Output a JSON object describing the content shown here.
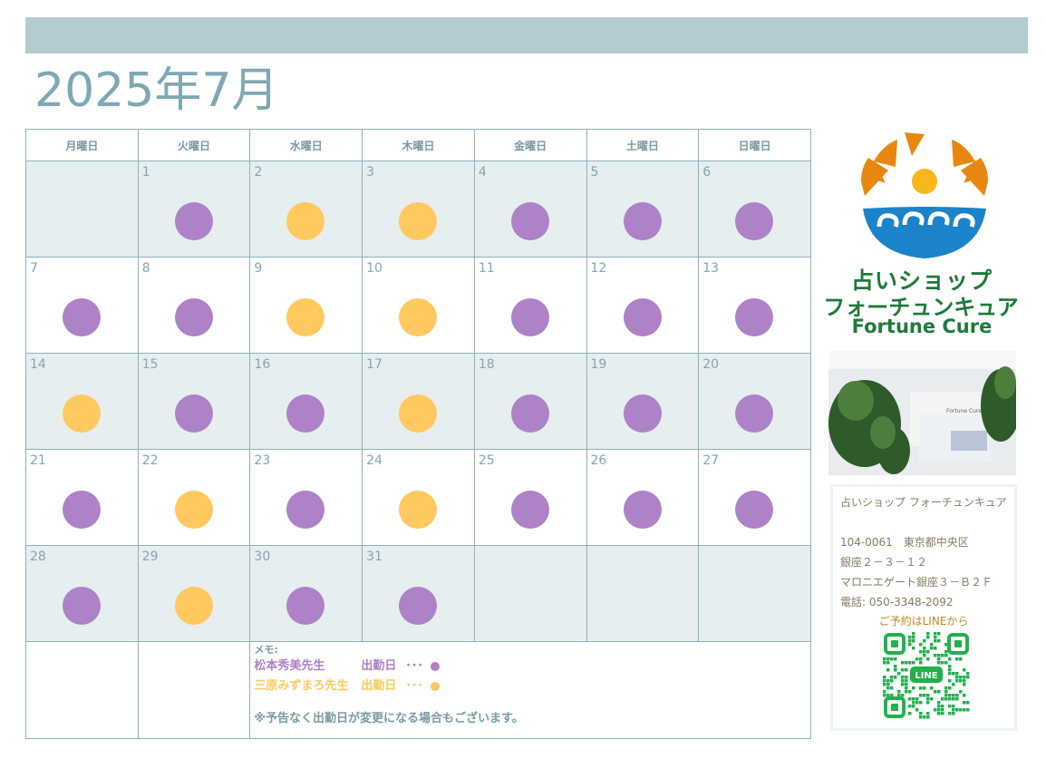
{
  "header": {
    "title": "2025年7月"
  },
  "weekdays": [
    "月曜日",
    "火曜日",
    "水曜日",
    "木曜日",
    "金曜日",
    "土曜日",
    "日曜日"
  ],
  "colors": {
    "purple": "#ad82c7",
    "yellow": "#ffc960",
    "header_bar": "#b4cbd1",
    "title": "#7ea8b4",
    "brand_green": "#1d7a3a"
  },
  "weeks": [
    {
      "shade": true,
      "days": [
        {
          "n": "",
          "dot": ""
        },
        {
          "n": "1",
          "dot": "purple"
        },
        {
          "n": "2",
          "dot": "yellow"
        },
        {
          "n": "3",
          "dot": "yellow"
        },
        {
          "n": "4",
          "dot": "purple"
        },
        {
          "n": "5",
          "dot": "purple"
        },
        {
          "n": "6",
          "dot": "purple"
        }
      ]
    },
    {
      "shade": false,
      "days": [
        {
          "n": "7",
          "dot": "purple"
        },
        {
          "n": "8",
          "dot": "purple"
        },
        {
          "n": "9",
          "dot": "yellow"
        },
        {
          "n": "10",
          "dot": "yellow"
        },
        {
          "n": "11",
          "dot": "purple"
        },
        {
          "n": "12",
          "dot": "purple"
        },
        {
          "n": "13",
          "dot": "purple"
        }
      ]
    },
    {
      "shade": true,
      "days": [
        {
          "n": "14",
          "dot": "yellow"
        },
        {
          "n": "15",
          "dot": "purple"
        },
        {
          "n": "16",
          "dot": "purple"
        },
        {
          "n": "17",
          "dot": "yellow"
        },
        {
          "n": "18",
          "dot": "purple"
        },
        {
          "n": "19",
          "dot": "purple"
        },
        {
          "n": "20",
          "dot": "purple"
        }
      ]
    },
    {
      "shade": false,
      "days": [
        {
          "n": "21",
          "dot": "purple"
        },
        {
          "n": "22",
          "dot": "yellow"
        },
        {
          "n": "23",
          "dot": "purple"
        },
        {
          "n": "24",
          "dot": "yellow"
        },
        {
          "n": "25",
          "dot": "purple"
        },
        {
          "n": "26",
          "dot": "purple"
        },
        {
          "n": "27",
          "dot": "purple"
        }
      ]
    },
    {
      "shade": true,
      "days": [
        {
          "n": "28",
          "dot": "purple"
        },
        {
          "n": "29",
          "dot": "yellow"
        },
        {
          "n": "30",
          "dot": "purple"
        },
        {
          "n": "31",
          "dot": "purple"
        },
        {
          "n": "",
          "dot": ""
        },
        {
          "n": "",
          "dot": ""
        },
        {
          "n": "",
          "dot": ""
        }
      ]
    }
  ],
  "memo": {
    "title": "メモ:",
    "teacher1": {
      "name": "松本秀美先生",
      "label": "出勤日",
      "dots": "･･･"
    },
    "teacher2": {
      "name": "三原みずまろ先生",
      "label": "出勤日",
      "dots": "･･･"
    },
    "note": "※予告なく出勤日が変更になる場合もございます。"
  },
  "brand": {
    "jp1": "占いショップ",
    "jp2": "フォーチュンキュア",
    "en": "Fortune Cure"
  },
  "info": {
    "shop": "占いショップ フォーチュンキュア",
    "postal": "104-0061　東京都中央区",
    "addr1": "銀座２－３－１２",
    "addr2": "マロニエゲート銀座３－Ｂ２Ｆ",
    "tel": "電話: 050-3348-2092",
    "reserve": "ご予約はLINEから",
    "qr_label": "LINE"
  }
}
